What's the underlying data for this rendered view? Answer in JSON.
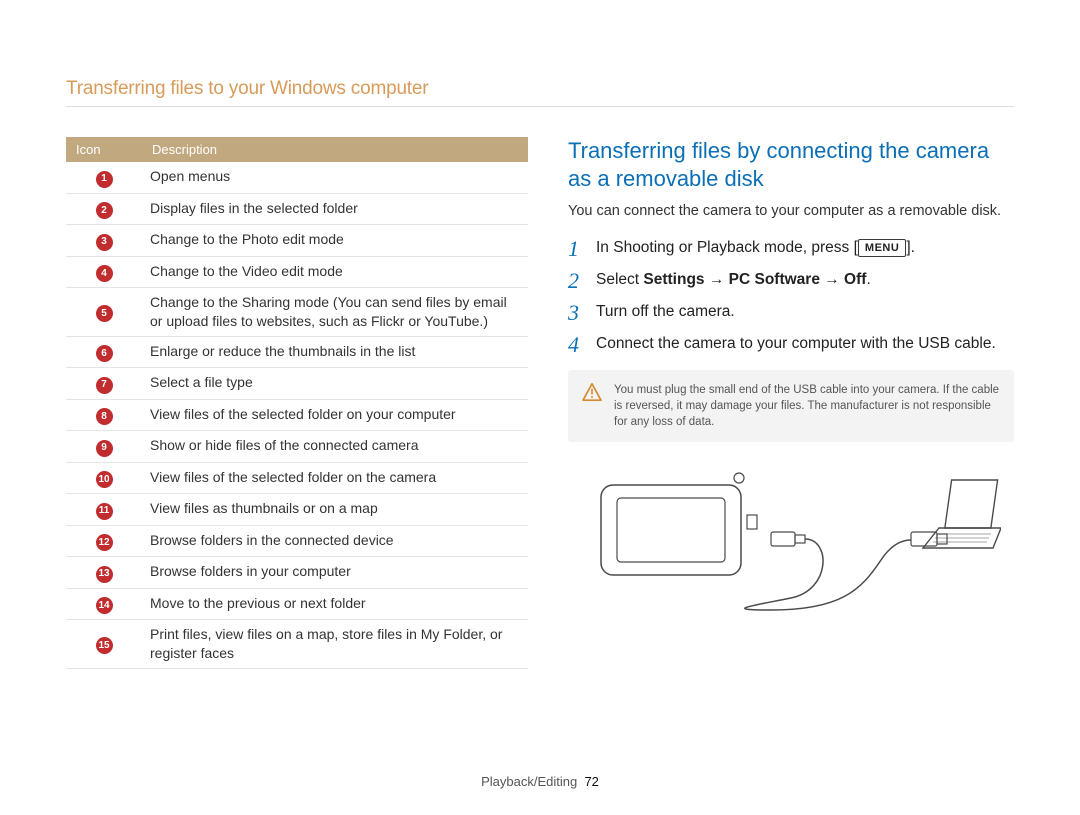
{
  "page_title": "Transferring files to your Windows computer",
  "table": {
    "head_icon": "Icon",
    "head_desc": "Description",
    "rows": [
      {
        "n": "1",
        "text": "Open menus"
      },
      {
        "n": "2",
        "text": "Display files in the selected folder"
      },
      {
        "n": "3",
        "text": "Change to the Photo edit mode"
      },
      {
        "n": "4",
        "text": "Change to the Video edit mode"
      },
      {
        "n": "5",
        "text": "Change to the Sharing mode (You can send files by email or upload files to websites, such as Flickr or YouTube.)"
      },
      {
        "n": "6",
        "text": "Enlarge or reduce the thumbnails in the list"
      },
      {
        "n": "7",
        "text": "Select a file type"
      },
      {
        "n": "8",
        "text": "View files of the selected folder on your computer"
      },
      {
        "n": "9",
        "text": "Show or hide files of the connected camera"
      },
      {
        "n": "10",
        "text": "View files of the selected folder on the camera"
      },
      {
        "n": "11",
        "text": "View files as thumbnails or on a map"
      },
      {
        "n": "12",
        "text": "Browse folders in the connected device"
      },
      {
        "n": "13",
        "text": "Browse folders in your computer"
      },
      {
        "n": "14",
        "text": "Move to the previous or next folder"
      },
      {
        "n": "15",
        "text": "Print files, view files on a map, store files in My Folder, or register faces"
      }
    ]
  },
  "section_title": "Transferring files by connecting the camera as a removable disk",
  "intro": "You can connect the camera to your computer as a removable disk.",
  "steps": {
    "s1": {
      "n": "1",
      "pre": "In Shooting or Playback mode, press [",
      "btn": "MENU",
      "post": "]."
    },
    "s2": {
      "n": "2",
      "pre": "Select ",
      "bold": "Settings → PC Software → Off",
      "post": "."
    },
    "s3": {
      "n": "3",
      "text": "Turn off the camera."
    },
    "s4": {
      "n": "4",
      "text": "Connect the camera to your computer with the USB cable."
    }
  },
  "notice": "You must plug the small end of the USB cable into your camera. If the cable is reversed, it may damage your files. The manufacturer is not responsible for any loss of data.",
  "footer": {
    "section": "Playback/Editing",
    "page": "72"
  }
}
